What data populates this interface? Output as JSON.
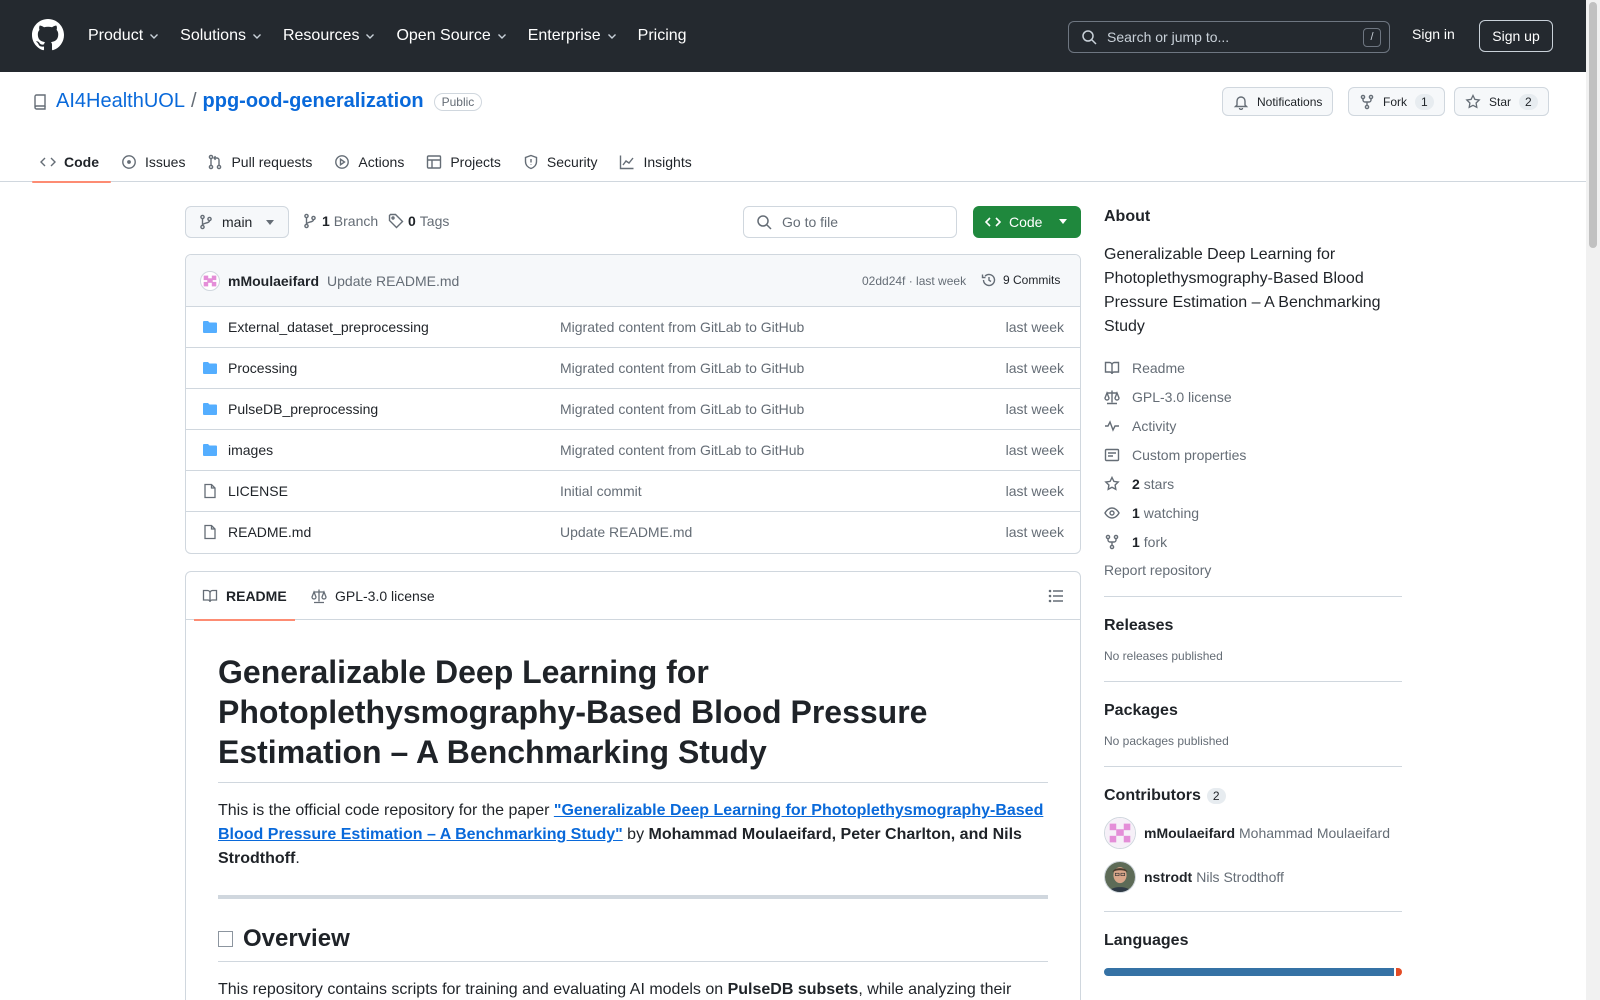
{
  "header": {
    "nav": [
      {
        "label": "Product",
        "has_menu": true
      },
      {
        "label": "Solutions",
        "has_menu": true
      },
      {
        "label": "Resources",
        "has_menu": true
      },
      {
        "label": "Open Source",
        "has_menu": true
      },
      {
        "label": "Enterprise",
        "has_menu": true
      },
      {
        "label": "Pricing",
        "has_menu": false
      }
    ],
    "search_placeholder": "Search or jump to...",
    "search_key": "/",
    "signin": "Sign in",
    "signup": "Sign up"
  },
  "repo": {
    "owner": "AI4HealthUOL",
    "separator": "/",
    "name": "ppg-ood-generalization",
    "visibility": "Public",
    "notifications_label": "Notifications",
    "fork_label": "Fork",
    "fork_count": "1",
    "star_label": "Star",
    "star_count": "2",
    "tabs": [
      {
        "label": "Code",
        "icon": "code-icon",
        "active": true
      },
      {
        "label": "Issues",
        "icon": "issue-icon",
        "active": false
      },
      {
        "label": "Pull requests",
        "icon": "pull-request-icon",
        "active": false
      },
      {
        "label": "Actions",
        "icon": "play-icon",
        "active": false
      },
      {
        "label": "Projects",
        "icon": "table-icon",
        "active": false
      },
      {
        "label": "Security",
        "icon": "shield-icon",
        "active": false
      },
      {
        "label": "Insights",
        "icon": "graph-icon",
        "active": false
      }
    ]
  },
  "toolbar": {
    "branch": "main",
    "branch_count": "1",
    "branch_label": "Branch",
    "tag_count": "0",
    "tag_label": "Tags",
    "goto_placeholder": "Go to file",
    "code_label": "Code"
  },
  "commit": {
    "author": "mMoulaeifard",
    "message": "Update README.md",
    "hash_time": "02dd24f · last week",
    "commits_label": "9 Commits"
  },
  "files": [
    {
      "type": "dir",
      "name": "External_dataset_preprocessing",
      "message": "Migrated content from GitLab to GitHub",
      "time": "last week"
    },
    {
      "type": "dir",
      "name": "Processing",
      "message": "Migrated content from GitLab to GitHub",
      "time": "last week"
    },
    {
      "type": "dir",
      "name": "PulseDB_preprocessing",
      "message": "Migrated content from GitLab to GitHub",
      "time": "last week"
    },
    {
      "type": "dir",
      "name": "images",
      "message": "Migrated content from GitLab to GitHub",
      "time": "last week"
    },
    {
      "type": "file",
      "name": "LICENSE",
      "message": "Initial commit",
      "time": "last week"
    },
    {
      "type": "file",
      "name": "README.md",
      "message": "Update README.md",
      "time": "last week"
    }
  ],
  "readme": {
    "tab_readme": "README",
    "tab_license": "GPL-3.0 license",
    "title": "Generalizable Deep Learning for Photoplethysmography-Based Blood Pressure Estimation – A Benchmarking Study",
    "intro_prefix": "This is the official code repository for the paper ",
    "intro_link": "\"Generalizable Deep Learning for Photoplethysmography-Based Blood Pressure Estimation – A Benchmarking Study\"",
    "intro_by": " by ",
    "intro_authors": "Mohammad Moulaeifard, Peter Charlton, and Nils Strodthoff",
    "intro_end": ".",
    "overview_heading": "Overview",
    "overview_prefix": "This repository contains scripts for training and evaluating AI models on ",
    "overview_bold": "PulseDB subsets",
    "overview_suffix": ", while analyzing their"
  },
  "about": {
    "heading": "About",
    "description": "Generalizable Deep Learning for Photoplethysmography-Based Blood Pressure Estimation – A Benchmarking Study",
    "links": [
      {
        "icon": "book-icon",
        "bold": "",
        "text": "Readme"
      },
      {
        "icon": "law-icon",
        "bold": "",
        "text": "GPL-3.0 license"
      },
      {
        "icon": "pulse-icon",
        "bold": "",
        "text": "Activity"
      },
      {
        "icon": "note-icon",
        "bold": "",
        "text": "Custom properties"
      },
      {
        "icon": "star-icon",
        "bold": "2",
        "text": "stars"
      },
      {
        "icon": "eye-icon",
        "bold": "1",
        "text": "watching"
      },
      {
        "icon": "fork-icon",
        "bold": "1",
        "text": "fork"
      }
    ],
    "report": "Report repository"
  },
  "releases": {
    "heading": "Releases",
    "text": "No releases published"
  },
  "packages": {
    "heading": "Packages",
    "text": "No packages published"
  },
  "contributors": {
    "heading": "Contributors",
    "count": "2",
    "list": [
      {
        "login": "mMoulaeifard",
        "name": "Mohammad Moulaeifard"
      },
      {
        "login": "nstrodt",
        "name": "Nils Strodthoff"
      }
    ]
  },
  "languages": {
    "heading": "Languages",
    "shares": [
      {
        "color": "#3572A5",
        "fraction": 0.98
      },
      {
        "color": "#e34c26",
        "fraction": 0.02
      }
    ]
  },
  "colors": {
    "link": "#0969da",
    "primary_button": "#1f883d",
    "active_tab_underline": "#fd8c73",
    "header_bg": "#24292f",
    "folder": "#54aeff"
  }
}
